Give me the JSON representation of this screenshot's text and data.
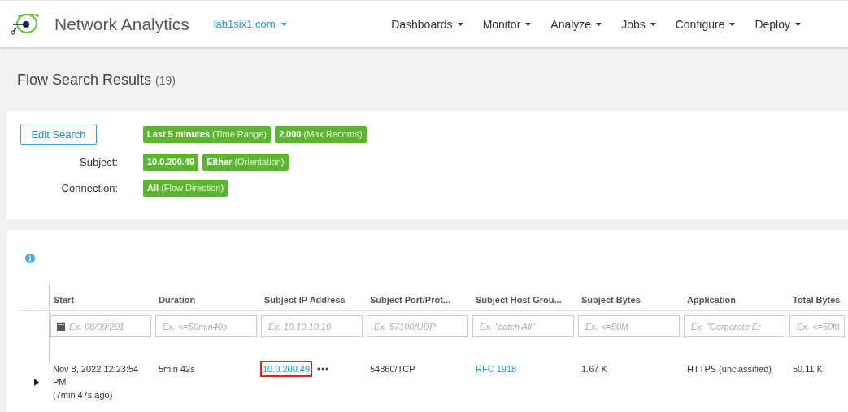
{
  "header": {
    "product": "Network Analytics",
    "domain": "lab1six1.com",
    "nav": [
      "Dashboards",
      "Monitor",
      "Analyze",
      "Jobs",
      "Configure",
      "Deploy"
    ]
  },
  "page": {
    "title": "Flow Search Results",
    "count": "(19)"
  },
  "search": {
    "edit_button": "Edit Search",
    "rows": [
      {
        "chips": [
          {
            "value": "Last 5 minutes",
            "qualifier": "(Time Range)"
          },
          {
            "value": "2,000",
            "qualifier": "(Max Records)"
          }
        ]
      },
      {
        "label": "Subject:",
        "chips": [
          {
            "value": "10.0.200.49"
          },
          {
            "value": "Either",
            "qualifier": "(Orientation)"
          }
        ]
      },
      {
        "label": "Connection:",
        "chips": [
          {
            "value": "All",
            "qualifier": "(Flow Direction)"
          }
        ]
      }
    ]
  },
  "table": {
    "columns": [
      {
        "label": "Start",
        "placeholder": "Ex. 06/09/201",
        "kind": "date"
      },
      {
        "label": "Duration",
        "placeholder": "Ex. <=50min40s",
        "kind": "text"
      },
      {
        "label": "Subject IP Address",
        "placeholder": "Ex. 10.10.10.10",
        "kind": "text"
      },
      {
        "label": "Subject Port/Prot...",
        "placeholder": "Ex. 57100/UDP",
        "kind": "text"
      },
      {
        "label": "Subject Host Grou...",
        "placeholder": "Ex. \"catch All\"",
        "kind": "text"
      },
      {
        "label": "Subject Bytes",
        "placeholder": "Ex. <=50M",
        "kind": "text"
      },
      {
        "label": "Application",
        "placeholder": "Ex. \"Corporate Er",
        "kind": "text"
      },
      {
        "label": "Total Bytes",
        "placeholder": "Ex. <=50M",
        "kind": "text"
      }
    ],
    "rows": [
      {
        "expanded": false,
        "cells": [
          {
            "kind": "text",
            "text": "Nov 8, 2022 12:23:54 PM",
            "note": "(7min 47s ago)"
          },
          {
            "kind": "text",
            "text": "5min 42s"
          },
          {
            "kind": "link",
            "text": "10.0.200.49",
            "highlighted": true,
            "more": true
          },
          {
            "kind": "text",
            "text": "54860/TCP"
          },
          {
            "kind": "link",
            "text": "RFC 1918"
          },
          {
            "kind": "text",
            "text": "1.67 K"
          },
          {
            "kind": "text",
            "text": "HTTPS (unclassified)"
          },
          {
            "kind": "text",
            "text": "50.11 K"
          }
        ]
      }
    ]
  }
}
